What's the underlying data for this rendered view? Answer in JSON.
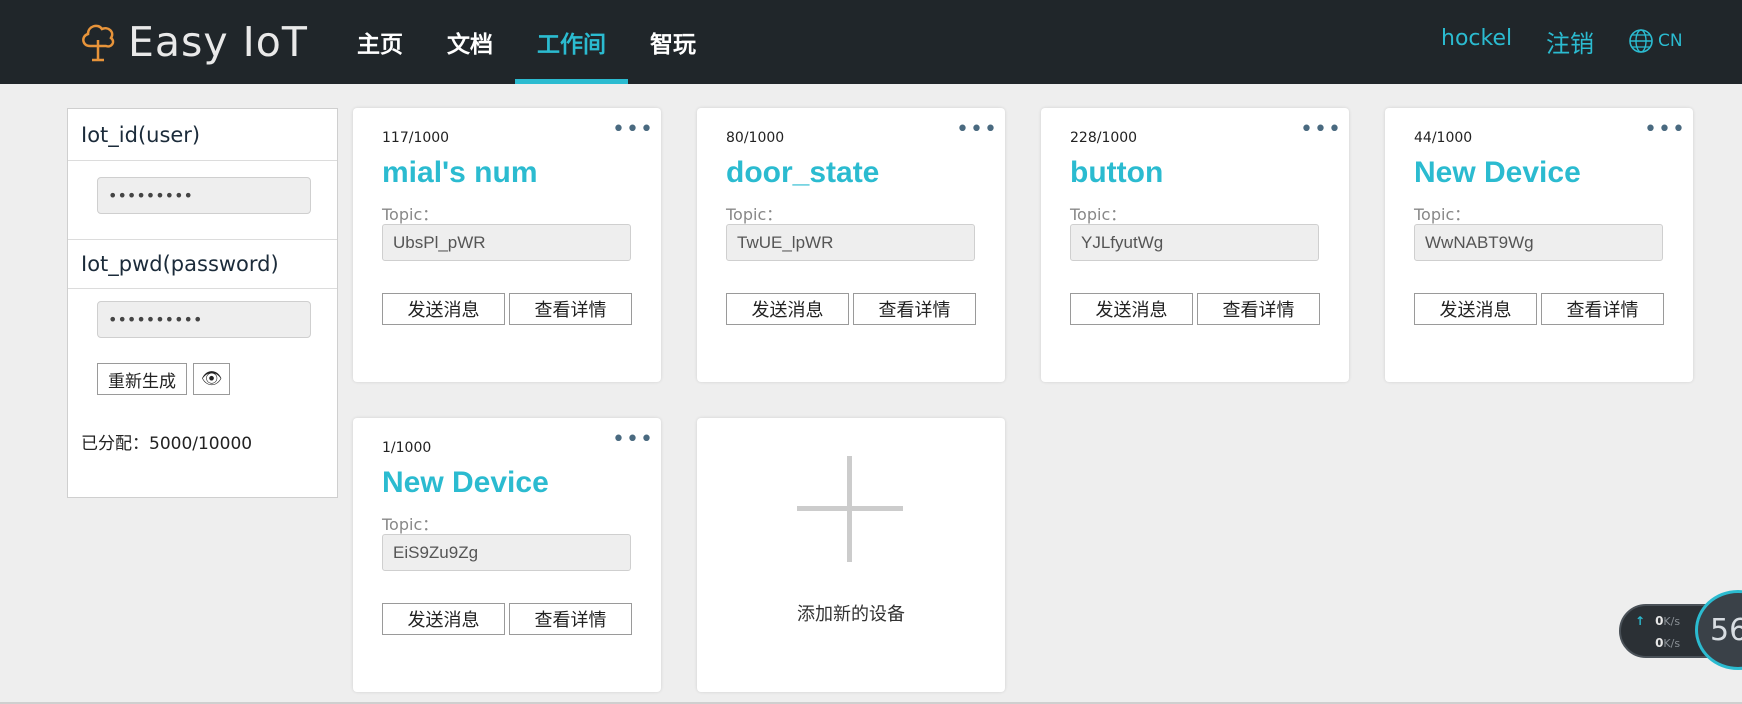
{
  "header": {
    "logo_text": "Easy IoT",
    "nav": [
      {
        "label": "主页"
      },
      {
        "label": "文档"
      },
      {
        "label": "工作间"
      },
      {
        "label": "智玩"
      }
    ],
    "active_nav": "工作间",
    "user": "hockel",
    "logout": "注销",
    "lang": "CN"
  },
  "sidebar": {
    "iot_id_label": "Iot_id(user)",
    "iot_id_value": "•••••••••",
    "iot_pwd_label": "Iot_pwd(password)",
    "iot_pwd_value": "••••••••••",
    "regen_label": "重新生成",
    "eye_icon": "👁",
    "allocated": "已分配：5000/10000"
  },
  "cards": [
    {
      "usage": "117/1000",
      "name": "mial's num",
      "topic_label": "Topic：",
      "topic": "UbsPl_pWR",
      "send": "发送消息",
      "detail": "查看详情",
      "more": "•••"
    },
    {
      "usage": "80/1000",
      "name": "door_state",
      "topic_label": "Topic：",
      "topic": "TwUE_lpWR",
      "send": "发送消息",
      "detail": "查看详情",
      "more": "•••"
    },
    {
      "usage": "228/1000",
      "name": "button",
      "topic_label": "Topic：",
      "topic": "YJLfyutWg",
      "send": "发送消息",
      "detail": "查看详情",
      "more": "•••"
    },
    {
      "usage": "44/1000",
      "name": "New Device",
      "topic_label": "Topic：",
      "topic": "WwNABT9Wg",
      "send": "发送消息",
      "detail": "查看详情",
      "more": "•••"
    },
    {
      "usage": "1/1000",
      "name": "New Device",
      "topic_label": "Topic：",
      "topic": "EiS9Zu9Zg",
      "send": "发送消息",
      "detail": "查看详情",
      "more": "•••"
    }
  ],
  "add_card": {
    "label": "添加新的设备"
  },
  "net_widget": {
    "up_value": "0",
    "down_value": "0",
    "unit": "K/s",
    "up_arrow": "↑",
    "percent": "56"
  },
  "colors": {
    "accent": "#2bbbd0",
    "header_bg": "#20262a",
    "page_bg": "#eeeeee"
  }
}
